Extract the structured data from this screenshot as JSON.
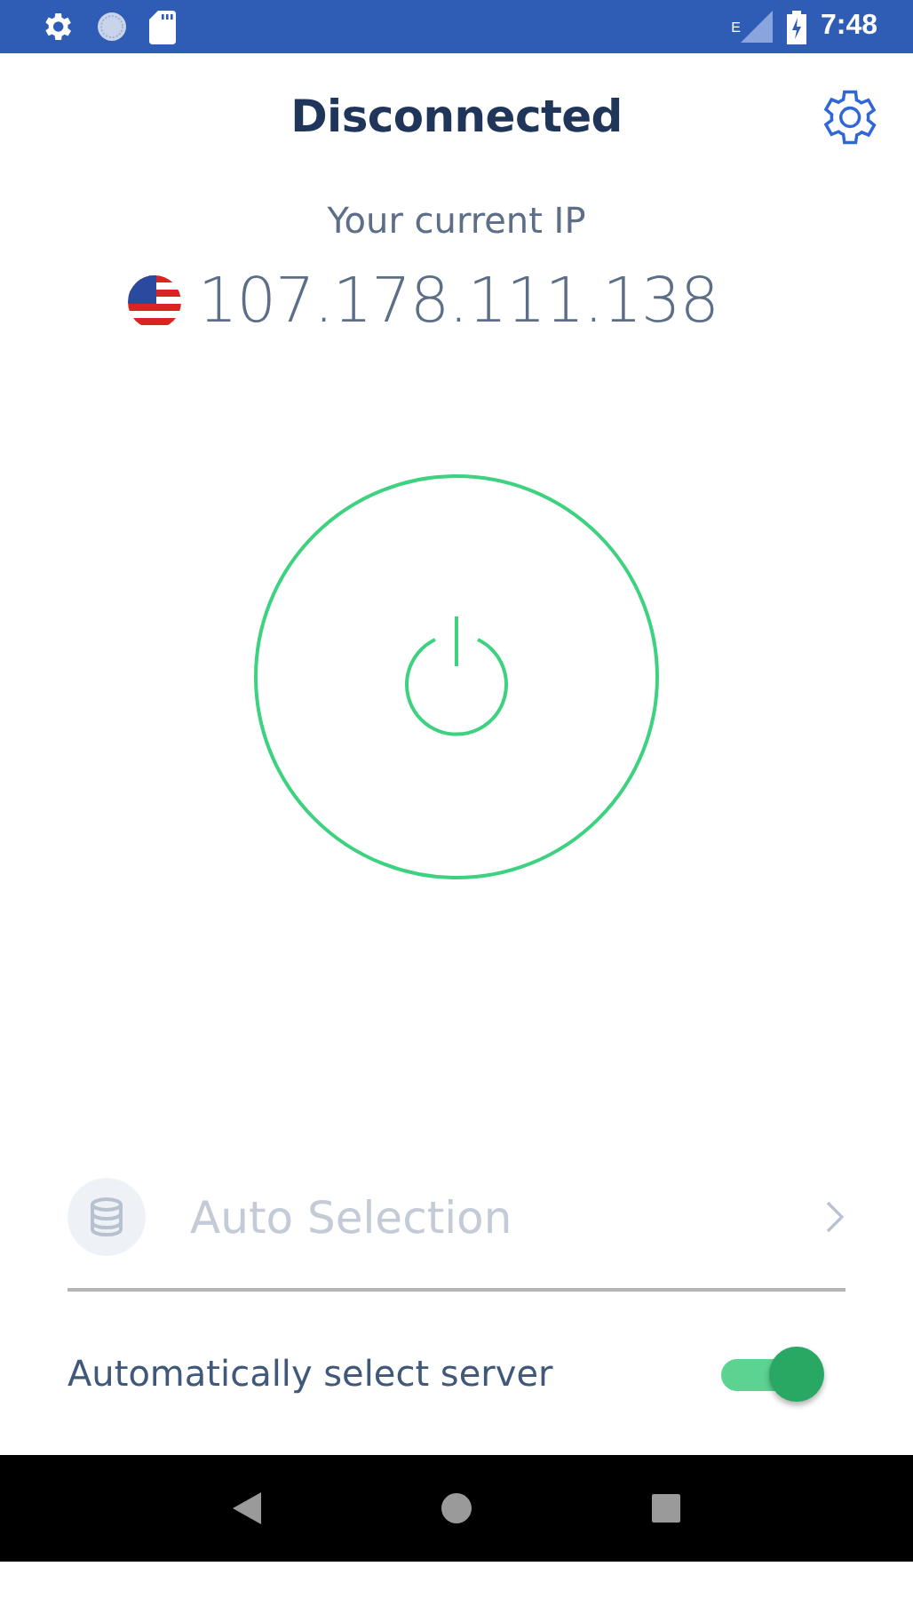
{
  "status_bar": {
    "network": "E",
    "time": "7:48"
  },
  "header": {
    "title": "Disconnected"
  },
  "ip": {
    "label": "Your current IP",
    "address": "107.178.111.138"
  },
  "server": {
    "label": "Auto Selection",
    "disabled": true
  },
  "auto_select": {
    "label": "Automatically select server",
    "on": true
  }
}
